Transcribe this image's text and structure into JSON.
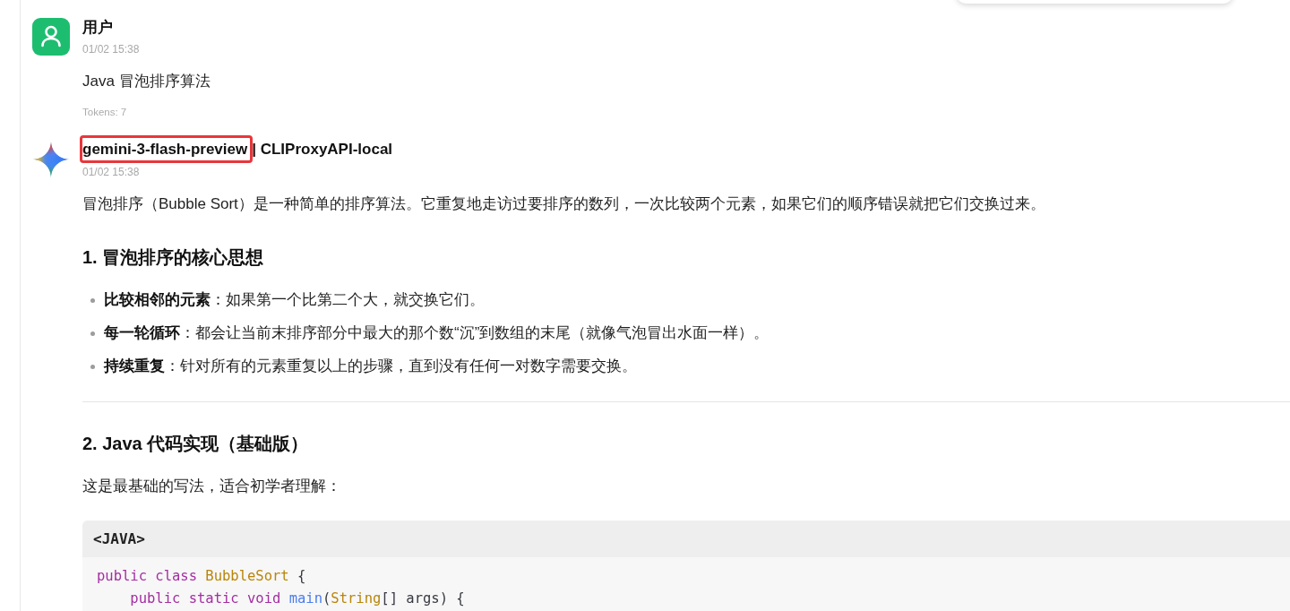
{
  "messages": [
    {
      "kind": "user",
      "name": "用户",
      "time": "01/02 15:38",
      "blocks": [
        {
          "kind": "paragraph",
          "text": "Java 冒泡排序算法"
        }
      ],
      "tokens": "Tokens: 7"
    },
    {
      "kind": "model",
      "name": "gemini-3-flash-preview",
      "highlighted": true,
      "provider": "| CLIProxyAPI-local",
      "time": "01/02 15:38",
      "blocks": [
        {
          "kind": "paragraph",
          "text": "冒泡排序（Bubble Sort）是一种简单的排序算法。它重复地走访过要排序的数列，一次比较两个元素，如果它们的顺序错误就把它们交换过来。"
        },
        {
          "kind": "heading",
          "text": "1. 冒泡排序的核心思想"
        },
        {
          "kind": "list",
          "items": [
            "**比较相邻的元素**：如果第一个比第二个大，就交换它们。",
            "**每一轮循环**：都会让当前末排序部分中最大的那个数“沉”到数组的末尾（就像气泡冒出水面一样）。",
            "**持续重复**：针对所有的元素重复以上的步骤，直到没有任何一对数字需要交换。"
          ]
        },
        {
          "kind": "divider"
        },
        {
          "kind": "heading",
          "text": "2. Java 代码实现（基础版）"
        },
        {
          "kind": "paragraph",
          "text": "这是最基础的写法，适合初学者理解："
        },
        {
          "kind": "code",
          "language": "<JAVA>",
          "lines": [
            [
              {
                "kind": "keyword",
                "text": "public class "
              },
              {
                "kind": "type",
                "text": "BubbleSort"
              },
              {
                "kind": "plain",
                "text": " {"
              }
            ],
            [
              {
                "kind": "keyword",
                "text": "    public static void "
              },
              {
                "kind": "function",
                "text": "main"
              },
              {
                "kind": "plain",
                "text": "("
              },
              {
                "kind": "type",
                "text": "String"
              },
              {
                "kind": "plain",
                "text": "[] args) {"
              }
            ]
          ]
        }
      ]
    }
  ]
}
